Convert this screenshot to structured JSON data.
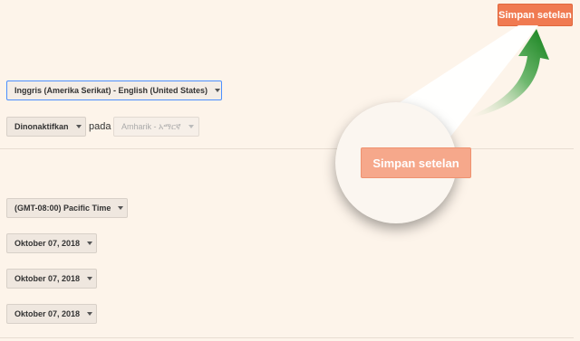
{
  "header": {
    "save_label": "Simpan setelan"
  },
  "language": {
    "selected": "Inggris (Amerika Serikat) - English (United States)"
  },
  "input_tools": {
    "status": "Dinonaktifkan",
    "connector": "pada",
    "language": "Amharik - አማርኛ"
  },
  "timezone": {
    "selected": "(GMT-08:00) Pacific Time"
  },
  "dates": [
    {
      "value": "Oktober 07, 2018"
    },
    {
      "value": "Oktober 07, 2018"
    },
    {
      "value": "Oktober 07, 2018"
    }
  ],
  "callout": {
    "save_label": "Simpan setelan",
    "arrow_color": "#1e8a1e"
  },
  "colors": {
    "accent": "#f07a51",
    "background": "#fdf4ea"
  }
}
